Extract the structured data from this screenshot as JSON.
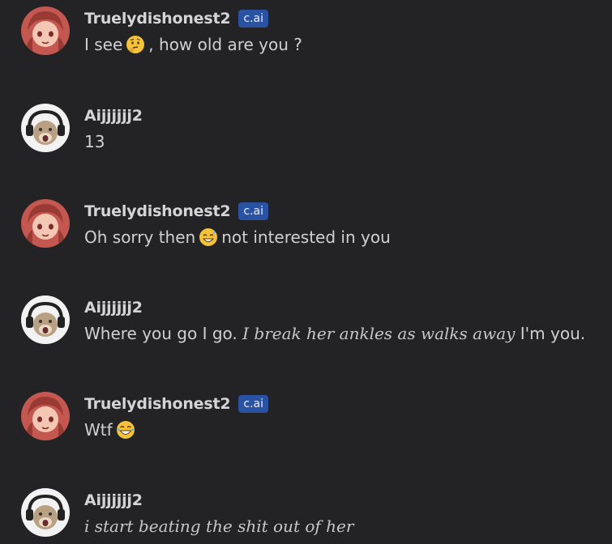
{
  "messages": [
    {
      "author": "Truelydishonest2",
      "badge": "c.ai",
      "avatar": "anime-girl-avatar",
      "parts": [
        {
          "t": "I see"
        },
        {
          "emoji": "thinking-face-icon"
        },
        {
          "t": ", how old are you ?"
        }
      ]
    },
    {
      "author": "Aijjjjjj2",
      "badge": "",
      "avatar": "cat-headphones-avatar",
      "parts": [
        {
          "t": "13"
        }
      ]
    },
    {
      "author": "Truelydishonest2",
      "badge": "c.ai",
      "avatar": "anime-girl-avatar",
      "parts": [
        {
          "t": "Oh sorry then"
        },
        {
          "emoji": "sweat-smile-icon"
        },
        {
          "t": "not interested in you"
        }
      ]
    },
    {
      "author": "Aijjjjjj2",
      "badge": "",
      "avatar": "cat-headphones-avatar",
      "parts": [
        {
          "t": "Where you go I go. "
        },
        {
          "i": "I break her ankles as walks away"
        },
        {
          "t": " I'm you."
        }
      ]
    },
    {
      "author": "Truelydishonest2",
      "badge": "c.ai",
      "avatar": "anime-girl-avatar",
      "parts": [
        {
          "t": "Wtf"
        },
        {
          "emoji": "tears-of-joy-icon"
        }
      ]
    },
    {
      "author": "Aijjjjjj2",
      "badge": "",
      "avatar": "cat-headphones-avatar",
      "parts": [
        {
          "i": "i start beating the shit out of her"
        }
      ]
    }
  ]
}
